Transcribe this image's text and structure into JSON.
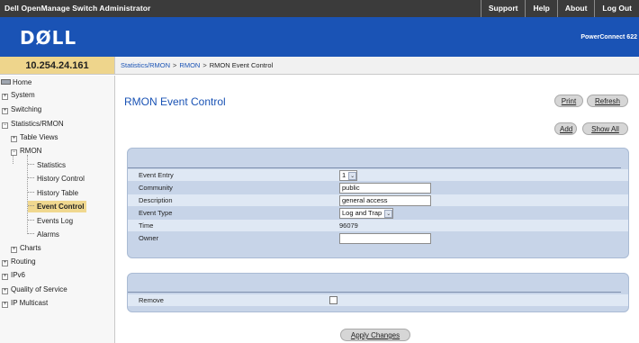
{
  "app": {
    "title": "Dell OpenManage Switch Administrator",
    "nav": [
      "Support",
      "Help",
      "About",
      "Log Out"
    ],
    "logo": "DØLL",
    "model": "PowerConnect 622"
  },
  "device": {
    "ip": "10.254.24.161"
  },
  "breadcrumb": {
    "items": [
      "Statistics/RMON",
      "RMON"
    ],
    "separator": ">",
    "current": "RMON Event Control"
  },
  "sidebar": {
    "home": "Home",
    "system": "System",
    "switching": "Switching",
    "stats": "Statistics/RMON",
    "table_views": "Table Views",
    "rmon": "RMON",
    "rmon_statistics": "Statistics",
    "history_control": "History Control",
    "history_table": "History Table",
    "event_control": "Event Control",
    "events_log": "Events Log",
    "alarms": "Alarms",
    "charts": "Charts",
    "routing": "Routing",
    "ipv6": "IPv6",
    "qos": "Quality of Service",
    "ip_multicast": "IP Multicast",
    "expand_glyph": "+",
    "collapse_glyph": "−"
  },
  "page": {
    "title": "RMON Event Control",
    "buttons": {
      "print": "Print",
      "refresh": "Refresh",
      "add": "Add",
      "show_all": "Show All",
      "apply": "Apply Changes"
    }
  },
  "form": {
    "event_entry": {
      "label": "Event Entry",
      "value": "1"
    },
    "community": {
      "label": "Community",
      "value": "public"
    },
    "description": {
      "label": "Description",
      "value": "general access"
    },
    "event_type": {
      "label": "Event Type",
      "value": "Log and Trap"
    },
    "time": {
      "label": "Time",
      "value": "96079"
    },
    "owner": {
      "label": "Owner",
      "value": ""
    },
    "remove": {
      "label": "Remove",
      "checked": false
    },
    "dropdown_glyph": "⌄"
  },
  "colors": {
    "top_bar": "#3b3b3b",
    "banner": "#1a53b5",
    "accent_link": "#1a53b5",
    "ip_box": "#eed58c",
    "active_tree_item": "#f0d88f",
    "panel": "#c7d4e8",
    "panel_row_alt": "#dfe8f4"
  }
}
